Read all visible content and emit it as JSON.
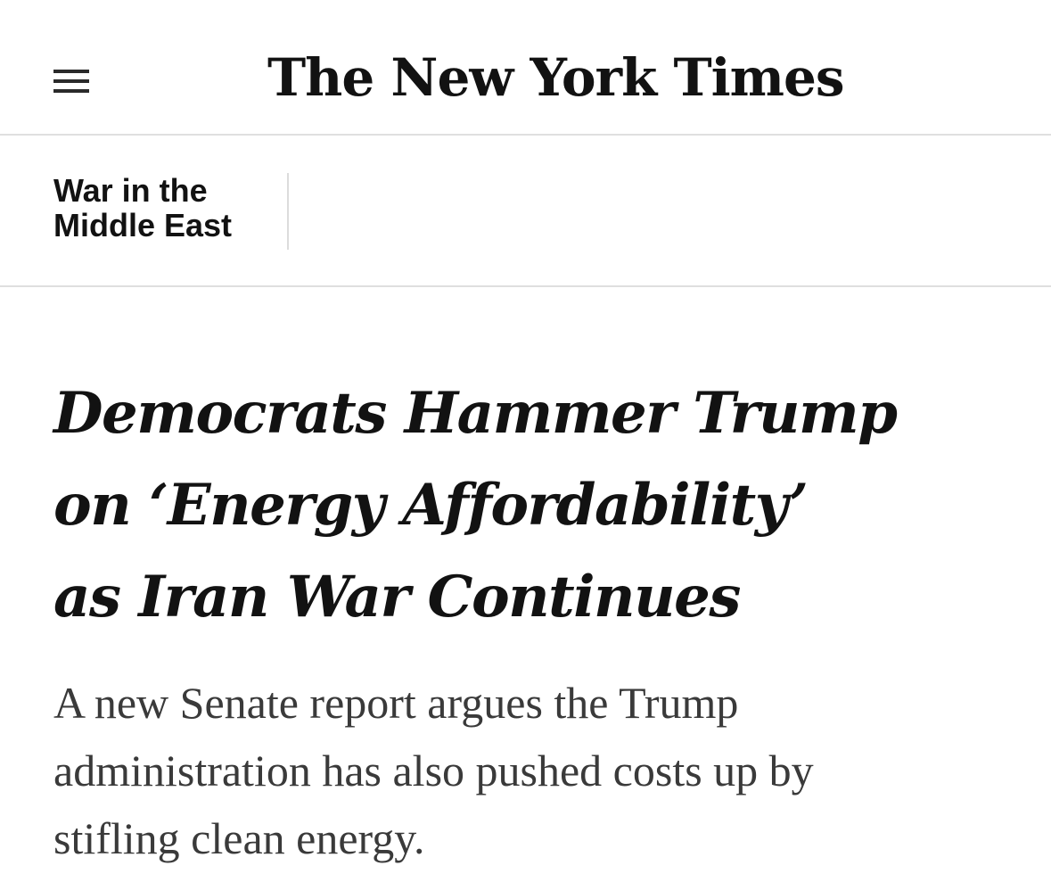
{
  "header": {
    "logo_text": "The New York Times",
    "menu_icon": "hamburger-menu-icon"
  },
  "section": {
    "label_line1": "War in the",
    "label_line2": "Middle East"
  },
  "article": {
    "headline_line1": "Democrats Hammer Trump",
    "headline_line2": "on ‘Energy Affordability’",
    "headline_line3": "as Iran War Continues",
    "summary_line1": "A new Senate report argues the Trump",
    "summary_line2": "administration has also pushed costs up by",
    "summary_line3": "stifling clean energy."
  },
  "colors": {
    "text": "#121212",
    "summary_text": "#3a3a3a",
    "divider": "#dfdfdf",
    "background": "#ffffff"
  }
}
